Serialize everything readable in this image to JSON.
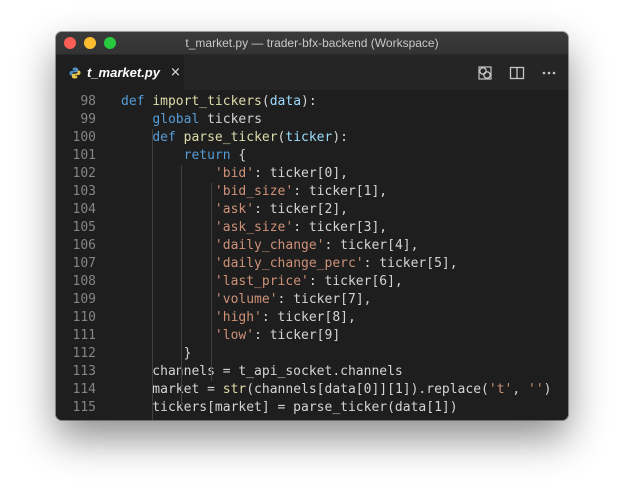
{
  "window": {
    "title": "t_market.py — trader-bfx-backend (Workspace)"
  },
  "tab": {
    "label": "t_market.py",
    "close": "×",
    "icon": "python-file-icon"
  },
  "actions": [
    {
      "name": "open-changes-icon"
    },
    {
      "name": "split-editor-icon"
    },
    {
      "name": "more-actions-icon"
    }
  ],
  "colors": {
    "keyword": "#569cd6",
    "function": "#dcdcaa",
    "param": "#9cdcfe",
    "string": "#ce9178",
    "plain": "#d4d4d4",
    "line_number": "#858585"
  },
  "code": [
    {
      "n": "98",
      "tokens": [
        [
          "keyword",
          "def "
        ],
        [
          "function",
          "import_tickers"
        ],
        [
          "plain",
          "("
        ],
        [
          "param",
          "data"
        ],
        [
          "plain",
          "):"
        ]
      ]
    },
    {
      "n": "99",
      "tokens": [
        [
          "plain",
          "    "
        ],
        [
          "keyword",
          "global"
        ],
        [
          "plain",
          " tickers"
        ]
      ]
    },
    {
      "n": "100",
      "tokens": [
        [
          "plain",
          "    "
        ],
        [
          "keyword",
          "def "
        ],
        [
          "function",
          "parse_ticker"
        ],
        [
          "plain",
          "("
        ],
        [
          "param",
          "ticker"
        ],
        [
          "plain",
          "):"
        ]
      ]
    },
    {
      "n": "101",
      "tokens": [
        [
          "plain",
          "        "
        ],
        [
          "keyword",
          "return"
        ],
        [
          "plain",
          " {"
        ]
      ]
    },
    {
      "n": "102",
      "tokens": [
        [
          "plain",
          "            "
        ],
        [
          "string",
          "'bid'"
        ],
        [
          "plain",
          ": ticker[0],"
        ]
      ]
    },
    {
      "n": "103",
      "tokens": [
        [
          "plain",
          "            "
        ],
        [
          "string",
          "'bid_size'"
        ],
        [
          "plain",
          ": ticker[1],"
        ]
      ]
    },
    {
      "n": "104",
      "tokens": [
        [
          "plain",
          "            "
        ],
        [
          "string",
          "'ask'"
        ],
        [
          "plain",
          ": ticker[2],"
        ]
      ]
    },
    {
      "n": "105",
      "tokens": [
        [
          "plain",
          "            "
        ],
        [
          "string",
          "'ask_size'"
        ],
        [
          "plain",
          ": ticker[3],"
        ]
      ]
    },
    {
      "n": "106",
      "tokens": [
        [
          "plain",
          "            "
        ],
        [
          "string",
          "'daily_change'"
        ],
        [
          "plain",
          ": ticker[4],"
        ]
      ]
    },
    {
      "n": "107",
      "tokens": [
        [
          "plain",
          "            "
        ],
        [
          "string",
          "'daily_change_perc'"
        ],
        [
          "plain",
          ": ticker[5],"
        ]
      ]
    },
    {
      "n": "108",
      "tokens": [
        [
          "plain",
          "            "
        ],
        [
          "string",
          "'last_price'"
        ],
        [
          "plain",
          ": ticker[6],"
        ]
      ]
    },
    {
      "n": "109",
      "tokens": [
        [
          "plain",
          "            "
        ],
        [
          "string",
          "'volume'"
        ],
        [
          "plain",
          ": ticker[7],"
        ]
      ]
    },
    {
      "n": "110",
      "tokens": [
        [
          "plain",
          "            "
        ],
        [
          "string",
          "'high'"
        ],
        [
          "plain",
          ": ticker[8],"
        ]
      ]
    },
    {
      "n": "111",
      "tokens": [
        [
          "plain",
          "            "
        ],
        [
          "string",
          "'low'"
        ],
        [
          "plain",
          ": ticker[9]"
        ]
      ]
    },
    {
      "n": "112",
      "tokens": [
        [
          "plain",
          "        }"
        ]
      ]
    },
    {
      "n": "113",
      "tokens": [
        [
          "plain",
          "    channels = t_api_socket.channels"
        ]
      ]
    },
    {
      "n": "114",
      "tokens": [
        [
          "plain",
          "    market = "
        ],
        [
          "builtin",
          "str"
        ],
        [
          "plain",
          "(channels[data[0]][1]).replace("
        ],
        [
          "string",
          "'t'"
        ],
        [
          "plain",
          ", "
        ],
        [
          "string",
          "''"
        ],
        [
          "plain",
          ")"
        ]
      ]
    },
    {
      "n": "115",
      "tokens": [
        [
          "plain",
          "    tickers[market] = parse_ticker(data[1])"
        ]
      ]
    }
  ]
}
